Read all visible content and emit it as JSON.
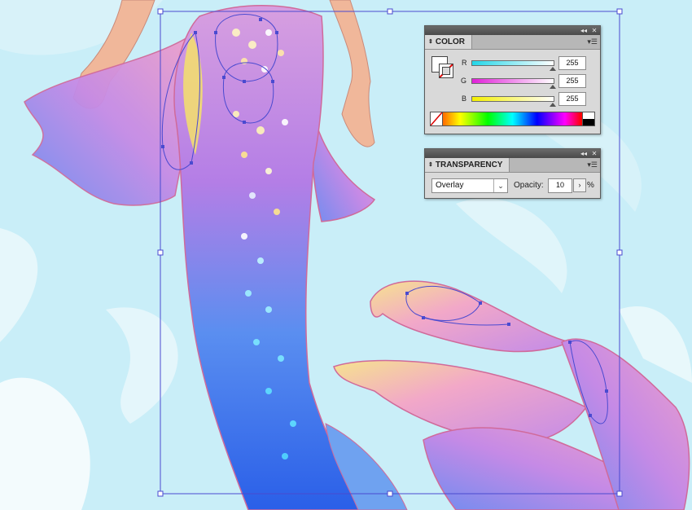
{
  "color_panel": {
    "title": "COLOR",
    "channels": [
      {
        "label": "R",
        "value": "255"
      },
      {
        "label": "G",
        "value": "255"
      },
      {
        "label": "B",
        "value": "255"
      }
    ],
    "fill_color": "#ffffff",
    "r_gradient": "#22d6e8",
    "g_gradient": "#e020d8",
    "b_gradient": "#f4f000"
  },
  "transparency_panel": {
    "title": "TRANSPARENCY",
    "blend_mode": "Overlay",
    "opacity_label": "Opacity:",
    "opacity_value": "10",
    "opacity_unit": "%"
  },
  "canvas": {
    "selection_color": "#4a4ad0",
    "background_color": "#c9eef8"
  }
}
